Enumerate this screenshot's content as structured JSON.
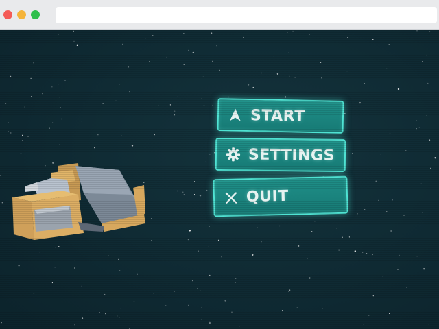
{
  "browser": {
    "window_controls": [
      "close",
      "minimize",
      "maximize"
    ],
    "address_bar_value": ""
  },
  "game": {
    "scene": "space-starfield",
    "menu": {
      "items": [
        {
          "id": "start",
          "label": "START",
          "icon": "play-arrow-icon"
        },
        {
          "id": "settings",
          "label": "SETTINGS",
          "icon": "gear-icon"
        },
        {
          "id": "quit",
          "label": "QUIT",
          "icon": "close-icon"
        }
      ]
    },
    "colors": {
      "background": "#0f2a33",
      "button_fill": "#1f8f88",
      "button_border": "#4fe3d3",
      "button_text": "#e6f3f1",
      "star": "#ffffff"
    }
  }
}
